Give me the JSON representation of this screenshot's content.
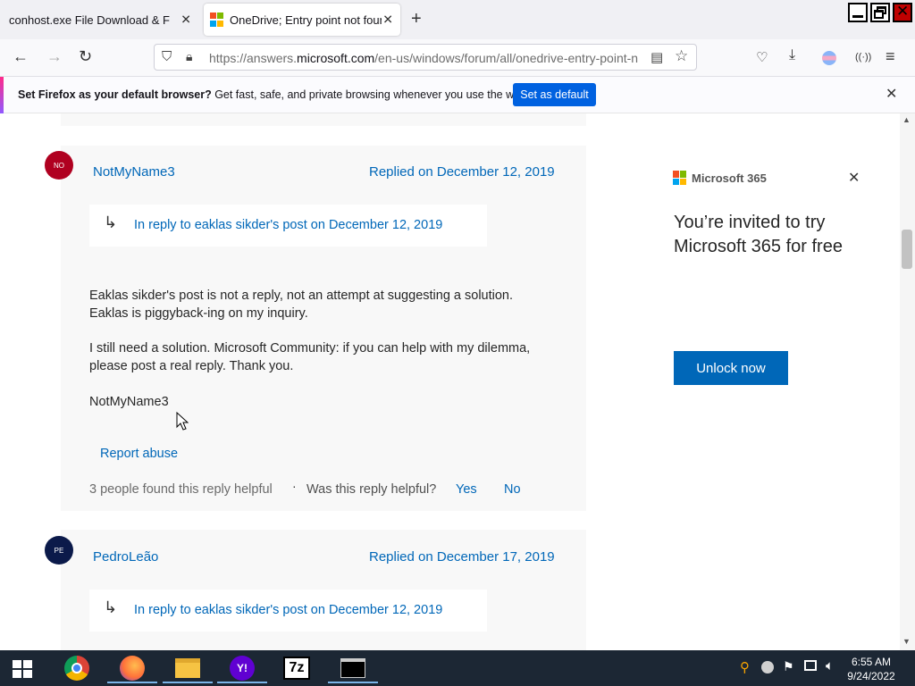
{
  "tabs": [
    {
      "title": "conhost.exe File Download & Fix For"
    },
    {
      "title": "OneDrive; Entry point not found"
    }
  ],
  "toolbar": {
    "url_prefix": "https://answers.",
    "url_domain": "microsoft.com",
    "url_path": "/en-us/windows/forum/all/onedrive-entry-point-n"
  },
  "notification": {
    "bold": "Set Firefox as your default browser?",
    "text": " Get fast, safe, and private browsing whenever you use the web.",
    "button": "Set as default"
  },
  "posts": [
    {
      "initials": "NO",
      "avatar_color": "#b00020",
      "author": "NotMyName3",
      "date": "Replied on December 12, 2019",
      "reply_arrow": "↳",
      "reply_to": "In reply to eaklas sikder's post on December 12, 2019",
      "body": [
        "Eaklas sikder's post is not a reply, not an attempt at suggesting a solution.",
        "Eaklas is piggyback-ing on my inquiry.",
        "I still need a solution.  Microsoft Community: if you can help with my dilemma,",
        "please post a real reply.  Thank you.",
        "NotMyName3"
      ],
      "report": "Report abuse",
      "helpful_count": "3 people found this reply helpful",
      "dot": "·",
      "helpful_question": "Was this reply helpful?",
      "yes": "Yes",
      "no": "No"
    },
    {
      "initials": "PE",
      "avatar_color": "#0b1a4a",
      "author": "PedroLeão",
      "date": "Replied on December 17, 2019",
      "reply_arrow": "↳",
      "reply_to": "In reply to eaklas sikder's post on December 12, 2019"
    }
  ],
  "ad": {
    "brand": "Microsoft 365",
    "headline_1": "You’re invited to try",
    "headline_2": "Microsoft 365 for free",
    "button": "Unlock now"
  },
  "taskbar": {
    "seven_zip": "7z",
    "time": "6:55 AM",
    "date": "9/24/2022"
  },
  "colors": {
    "accent": "#0067b8",
    "firefox_button": "#0061e0",
    "taskbar": "#1c2734"
  }
}
